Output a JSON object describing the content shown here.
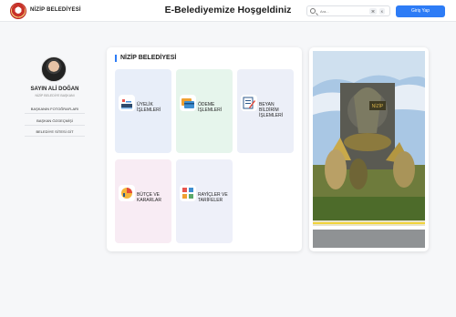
{
  "header": {
    "brand": "NİZİP BELEDİYESİ",
    "welcome": "E-Belediyemize Hoşgeldiniz",
    "search": {
      "placeholder": "Ara...",
      "shortcut1": "⌘",
      "shortcut2": "K"
    },
    "login_label": "Giriş Yap"
  },
  "profile": {
    "name": "SAYIN ALİ DOĞAN",
    "role": "NİZİP BELEDİYE BAŞKANI",
    "links": [
      {
        "label": "BAŞKANIN FOTOĞRAFLARI"
      },
      {
        "label": "BAŞKAN ÖZGEÇMİŞİ"
      },
      {
        "label": "BELEDİYE SİTESİ GİT"
      }
    ]
  },
  "services": {
    "title": "NİZİP BELEDİYESİ",
    "tiles": [
      {
        "label": "ÜYELİK İŞLEMLERİ",
        "icon": "membership-icon"
      },
      {
        "label": "ÖDEME İŞLEMLERİ",
        "icon": "payment-card-icon"
      },
      {
        "label": "BEYAN BİLDİRİM İŞLEMLERİ",
        "icon": "declaration-form-icon"
      },
      {
        "label": "BÜTÇE VE KARARLAR",
        "icon": "budget-chart-icon"
      },
      {
        "label": "RAYİÇLER VE TARİFELER",
        "icon": "tariff-icon"
      }
    ]
  },
  "photo": {
    "plaque": "NİZİP"
  },
  "colors": {
    "accent": "#2d7cf6"
  }
}
